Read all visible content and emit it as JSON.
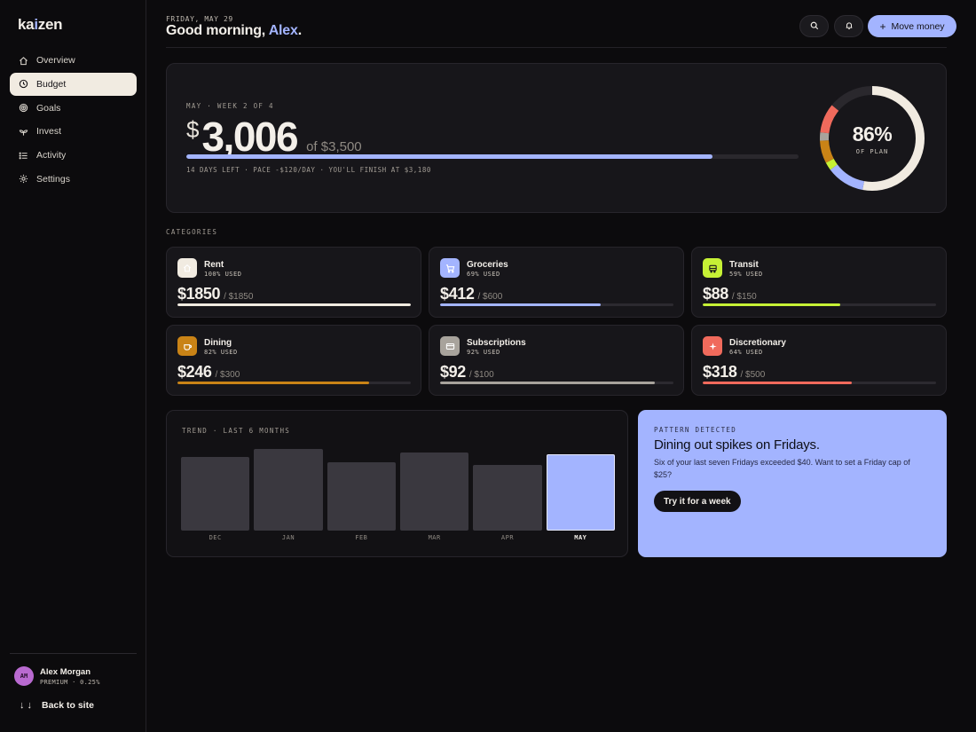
{
  "brand": {
    "logo_left": "ka",
    "logo_dot": "i",
    "logo_right": "zen"
  },
  "sidebar": {
    "items": [
      {
        "label": "Overview",
        "icon": "home-icon"
      },
      {
        "label": "Budget",
        "icon": "clock-icon",
        "active": true
      },
      {
        "label": "Goals",
        "icon": "target-icon"
      },
      {
        "label": "Invest",
        "icon": "sprout-icon"
      },
      {
        "label": "Activity",
        "icon": "list-icon"
      },
      {
        "label": "Settings",
        "icon": "gear-icon"
      }
    ],
    "profile": {
      "initials": "AM",
      "name": "Alex Morgan",
      "plan": "PREMIUM · 0.25%"
    },
    "back_link": "Back to site"
  },
  "header": {
    "date": "FRIDAY, MAY 29",
    "greeting_prefix": "Good morning, ",
    "greeting_name": "Alex",
    "greeting_suffix": ".",
    "move_money_label": "Move money"
  },
  "hero": {
    "period": "MAY · WEEK 2 OF 4",
    "currency": "$",
    "spent": "3,006",
    "of_plan": "of $3,500",
    "progress": 0.86,
    "subtitle": "14 DAYS LEFT · PACE -$120/DAY · YOU'LL FINISH AT $3,180",
    "donut_pct": "86%",
    "donut_label": "OF PLAN",
    "donut_segments": [
      {
        "name": "Rent",
        "fraction": 0.529,
        "color": "#f1ebe1"
      },
      {
        "name": "Groceries",
        "fraction": 0.118,
        "color": "#a3b4ff"
      },
      {
        "name": "Transit",
        "fraction": 0.025,
        "color": "#c6f135"
      },
      {
        "name": "Dining",
        "fraction": 0.07,
        "color": "#c98316"
      },
      {
        "name": "Subscriptions",
        "fraction": 0.026,
        "color": "#a8a39c"
      },
      {
        "name": "Discretionary",
        "fraction": 0.091,
        "color": "#f06a5c"
      }
    ]
  },
  "categories": {
    "title": "CATEGORIES",
    "items": [
      {
        "name": "Rent",
        "used": "100% USED",
        "spent": "$1850",
        "limit": "/ $1850",
        "fraction": 1.0,
        "color": "#f1ebe1",
        "icon": "home-icon"
      },
      {
        "name": "Groceries",
        "used": "69% USED",
        "spent": "$412",
        "limit": "/ $600",
        "fraction": 0.69,
        "color": "#a3b4ff",
        "icon": "cart-icon"
      },
      {
        "name": "Transit",
        "used": "59% USED",
        "spent": "$88",
        "limit": "/ $150",
        "fraction": 0.59,
        "color": "#c6f135",
        "icon": "bus-icon"
      },
      {
        "name": "Dining",
        "used": "82% USED",
        "spent": "$246",
        "limit": "/ $300",
        "fraction": 0.82,
        "color": "#c98316",
        "icon": "cup-icon"
      },
      {
        "name": "Subscriptions",
        "used": "92% USED",
        "spent": "$92",
        "limit": "/ $100",
        "fraction": 0.92,
        "color": "#a8a39c",
        "icon": "card-icon"
      },
      {
        "name": "Discretionary",
        "used": "64% USED",
        "spent": "$318",
        "limit": "/ $500",
        "fraction": 0.64,
        "color": "#f06a5c",
        "icon": "sparkle-icon"
      }
    ]
  },
  "trend": {
    "title": "TREND · LAST 6 MONTHS",
    "chart_data": {
      "type": "bar",
      "categories": [
        "DEC",
        "JAN",
        "FEB",
        "MAR",
        "APR",
        "MAY"
      ],
      "values": [
        0.87,
        0.97,
        0.81,
        0.93,
        0.78,
        0.91
      ],
      "highlight": "MAY",
      "ylim": [
        0,
        1
      ]
    }
  },
  "insight": {
    "label": "PATTERN DETECTED",
    "title": "Dining out spikes on Fridays.",
    "body": "Six of your last seven Fridays exceeded $40. Want to set a Friday cap of $25?",
    "button": "Try it for a week"
  }
}
